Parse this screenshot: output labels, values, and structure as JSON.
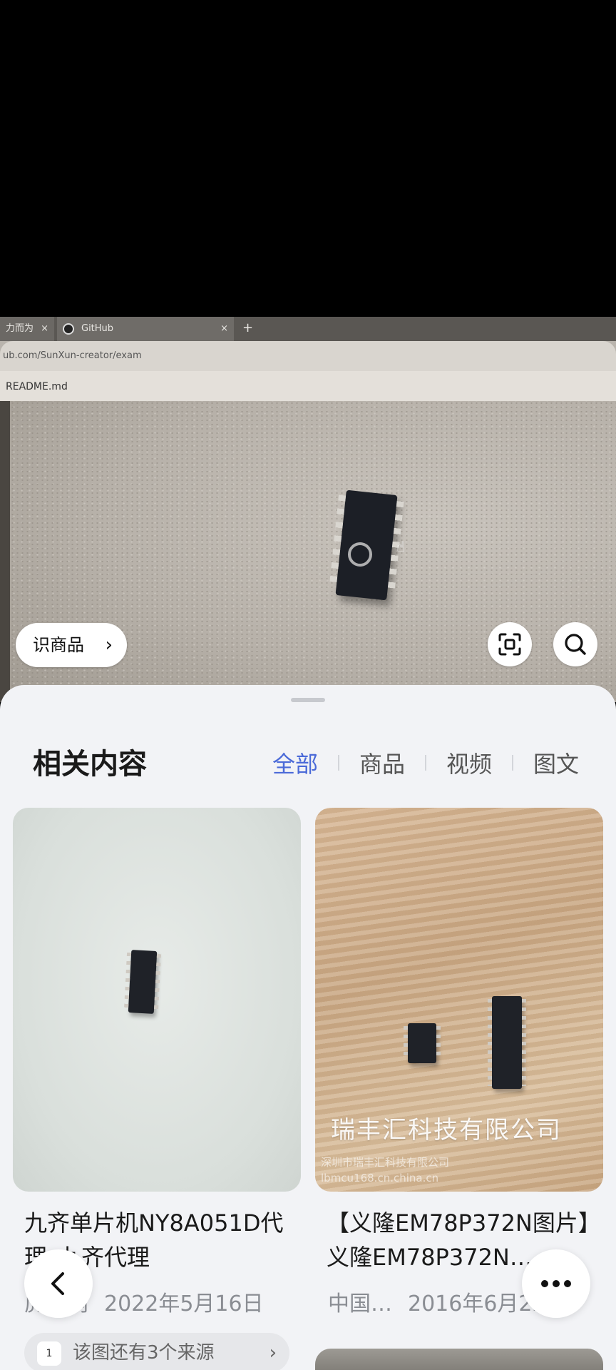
{
  "photo": {
    "screen_tabs": [
      "力而为",
      "GitHub"
    ],
    "url_text": "ub.com/SunXun-creator/exam",
    "file_text": "README.md",
    "identify_button": "识商品",
    "crop_icon": "scan-crop-icon",
    "search_icon": "search-icon"
  },
  "sheet": {
    "title": "相关内容",
    "filters": [
      "全部",
      "商品",
      "视频",
      "图文"
    ],
    "active_filter": "全部",
    "accent_color": "#4b6ad8"
  },
  "results": [
    {
      "title": "九齐单片机NY8A051D代理_九齐代理",
      "source": "虎易网",
      "date": "2022年5月16日",
      "sources_note": "该图还有3个来源"
    },
    {
      "title": "【义隆EM78P372N图片】义隆EM78P372N…",
      "source": "中国…",
      "date": "2016年6月22日",
      "watermark_big": "瑞丰汇科技有限公司",
      "watermark_small_1": "深圳市瑞丰汇科技有限公司",
      "watermark_small_2": "lbmcu168.cn.china.cn"
    }
  ],
  "nav": {
    "back_icon": "back-chevron-icon",
    "more_icon": "more-dots-icon"
  }
}
